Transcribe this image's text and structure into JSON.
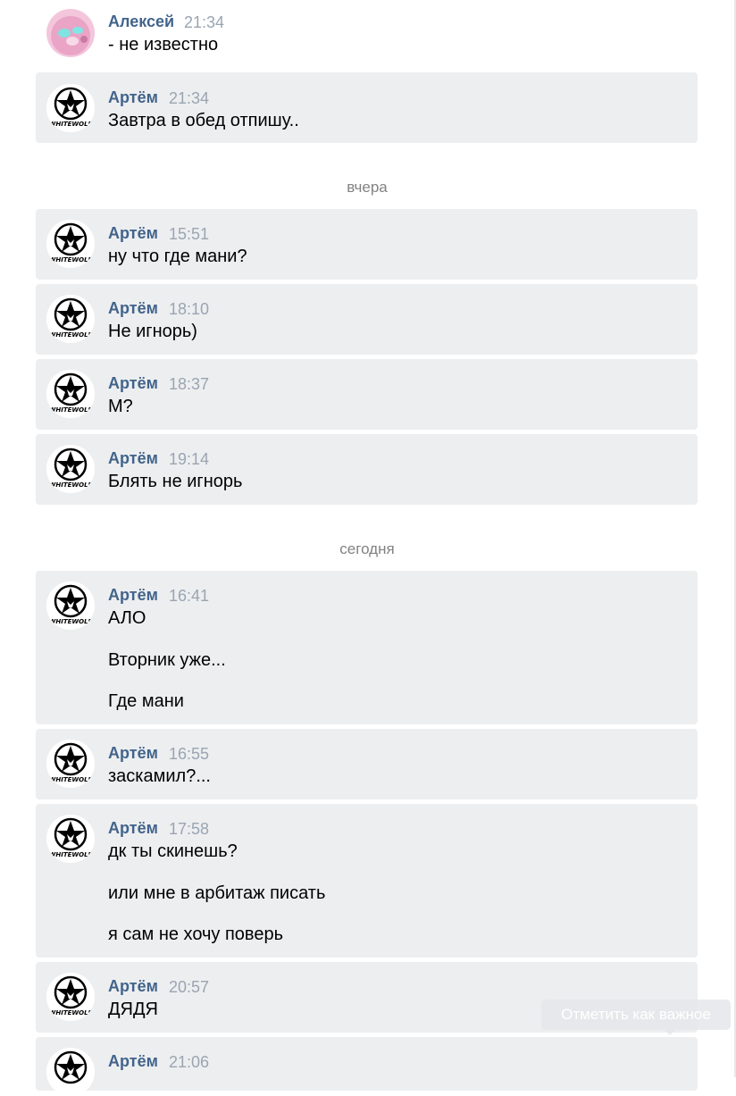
{
  "messages": [
    {
      "author": "Алексей",
      "time": "21:34",
      "lines": [
        "- не известно"
      ]
    },
    {
      "author": "Артём",
      "time": "21:34",
      "lines": [
        "Завтра в обед отпишу.."
      ]
    },
    {
      "author": "Артём",
      "time": "15:51",
      "lines": [
        "ну что где мани?"
      ]
    },
    {
      "author": "Артём",
      "time": "18:10",
      "lines": [
        "Не игнорь)"
      ]
    },
    {
      "author": "Артём",
      "time": "18:37",
      "lines": [
        "М?"
      ]
    },
    {
      "author": "Артём",
      "time": "19:14",
      "lines": [
        "Блять не игнорь"
      ]
    },
    {
      "author": "Артём",
      "time": "16:41",
      "lines": [
        "АЛО",
        "Вторник уже...",
        "Где мани"
      ]
    },
    {
      "author": "Артём",
      "time": "16:55",
      "lines": [
        "заскамил?..."
      ]
    },
    {
      "author": "Артём",
      "time": "17:58",
      "lines": [
        "дк ты скинешь?",
        "или мне в арбитаж писать",
        "я сам не хочу поверь"
      ]
    },
    {
      "author": "Артём",
      "time": "20:57",
      "lines": [
        "ДЯДЯ"
      ]
    },
    {
      "author": "Артём",
      "time": "21:06",
      "lines": []
    }
  ],
  "dividers": [
    "вчера",
    "сегодня"
  ],
  "tooltip": {
    "label": "Отметить как важное"
  },
  "avatars": {
    "alexey": {
      "icon": "pink-character-avatar-icon"
    },
    "artem": {
      "icon": "whitewolf-star-logo-icon",
      "logo_text": "WHITEWOLF"
    }
  },
  "colors": {
    "author": "#42648b",
    "time": "#9aa5b1",
    "selected_bg": "#edeef0",
    "divider": "#828282"
  }
}
